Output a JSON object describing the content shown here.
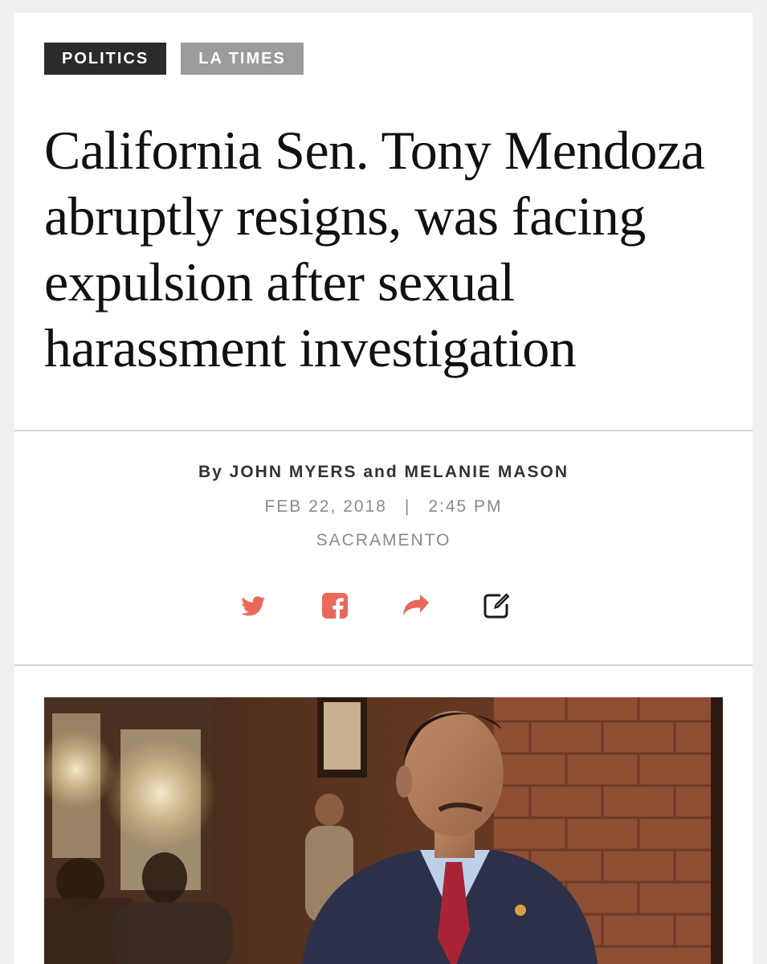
{
  "tags": [
    {
      "label": "POLITICS",
      "color": "#2b2b2b"
    },
    {
      "label": "LA TIMES",
      "color": "#9b9b9b"
    }
  ],
  "headline": "California Sen. Tony Mendoza abruptly resigns, was facing expulsion after sexual harassment investigation",
  "byline": {
    "prefix": "By",
    "author1": "JOHN MYERS",
    "connector": "and",
    "author2": "MELANIE MASON"
  },
  "dateline": {
    "date": "FEB 22, 2018",
    "separator": "|",
    "time": "2:45 PM"
  },
  "location": "SACRAMENTO",
  "share": {
    "accent_color": "#e8695a",
    "icons": [
      "twitter-icon",
      "facebook-icon",
      "share-arrow-icon",
      "edit-icon"
    ]
  },
  "photo": {
    "icon": "article-photo"
  }
}
